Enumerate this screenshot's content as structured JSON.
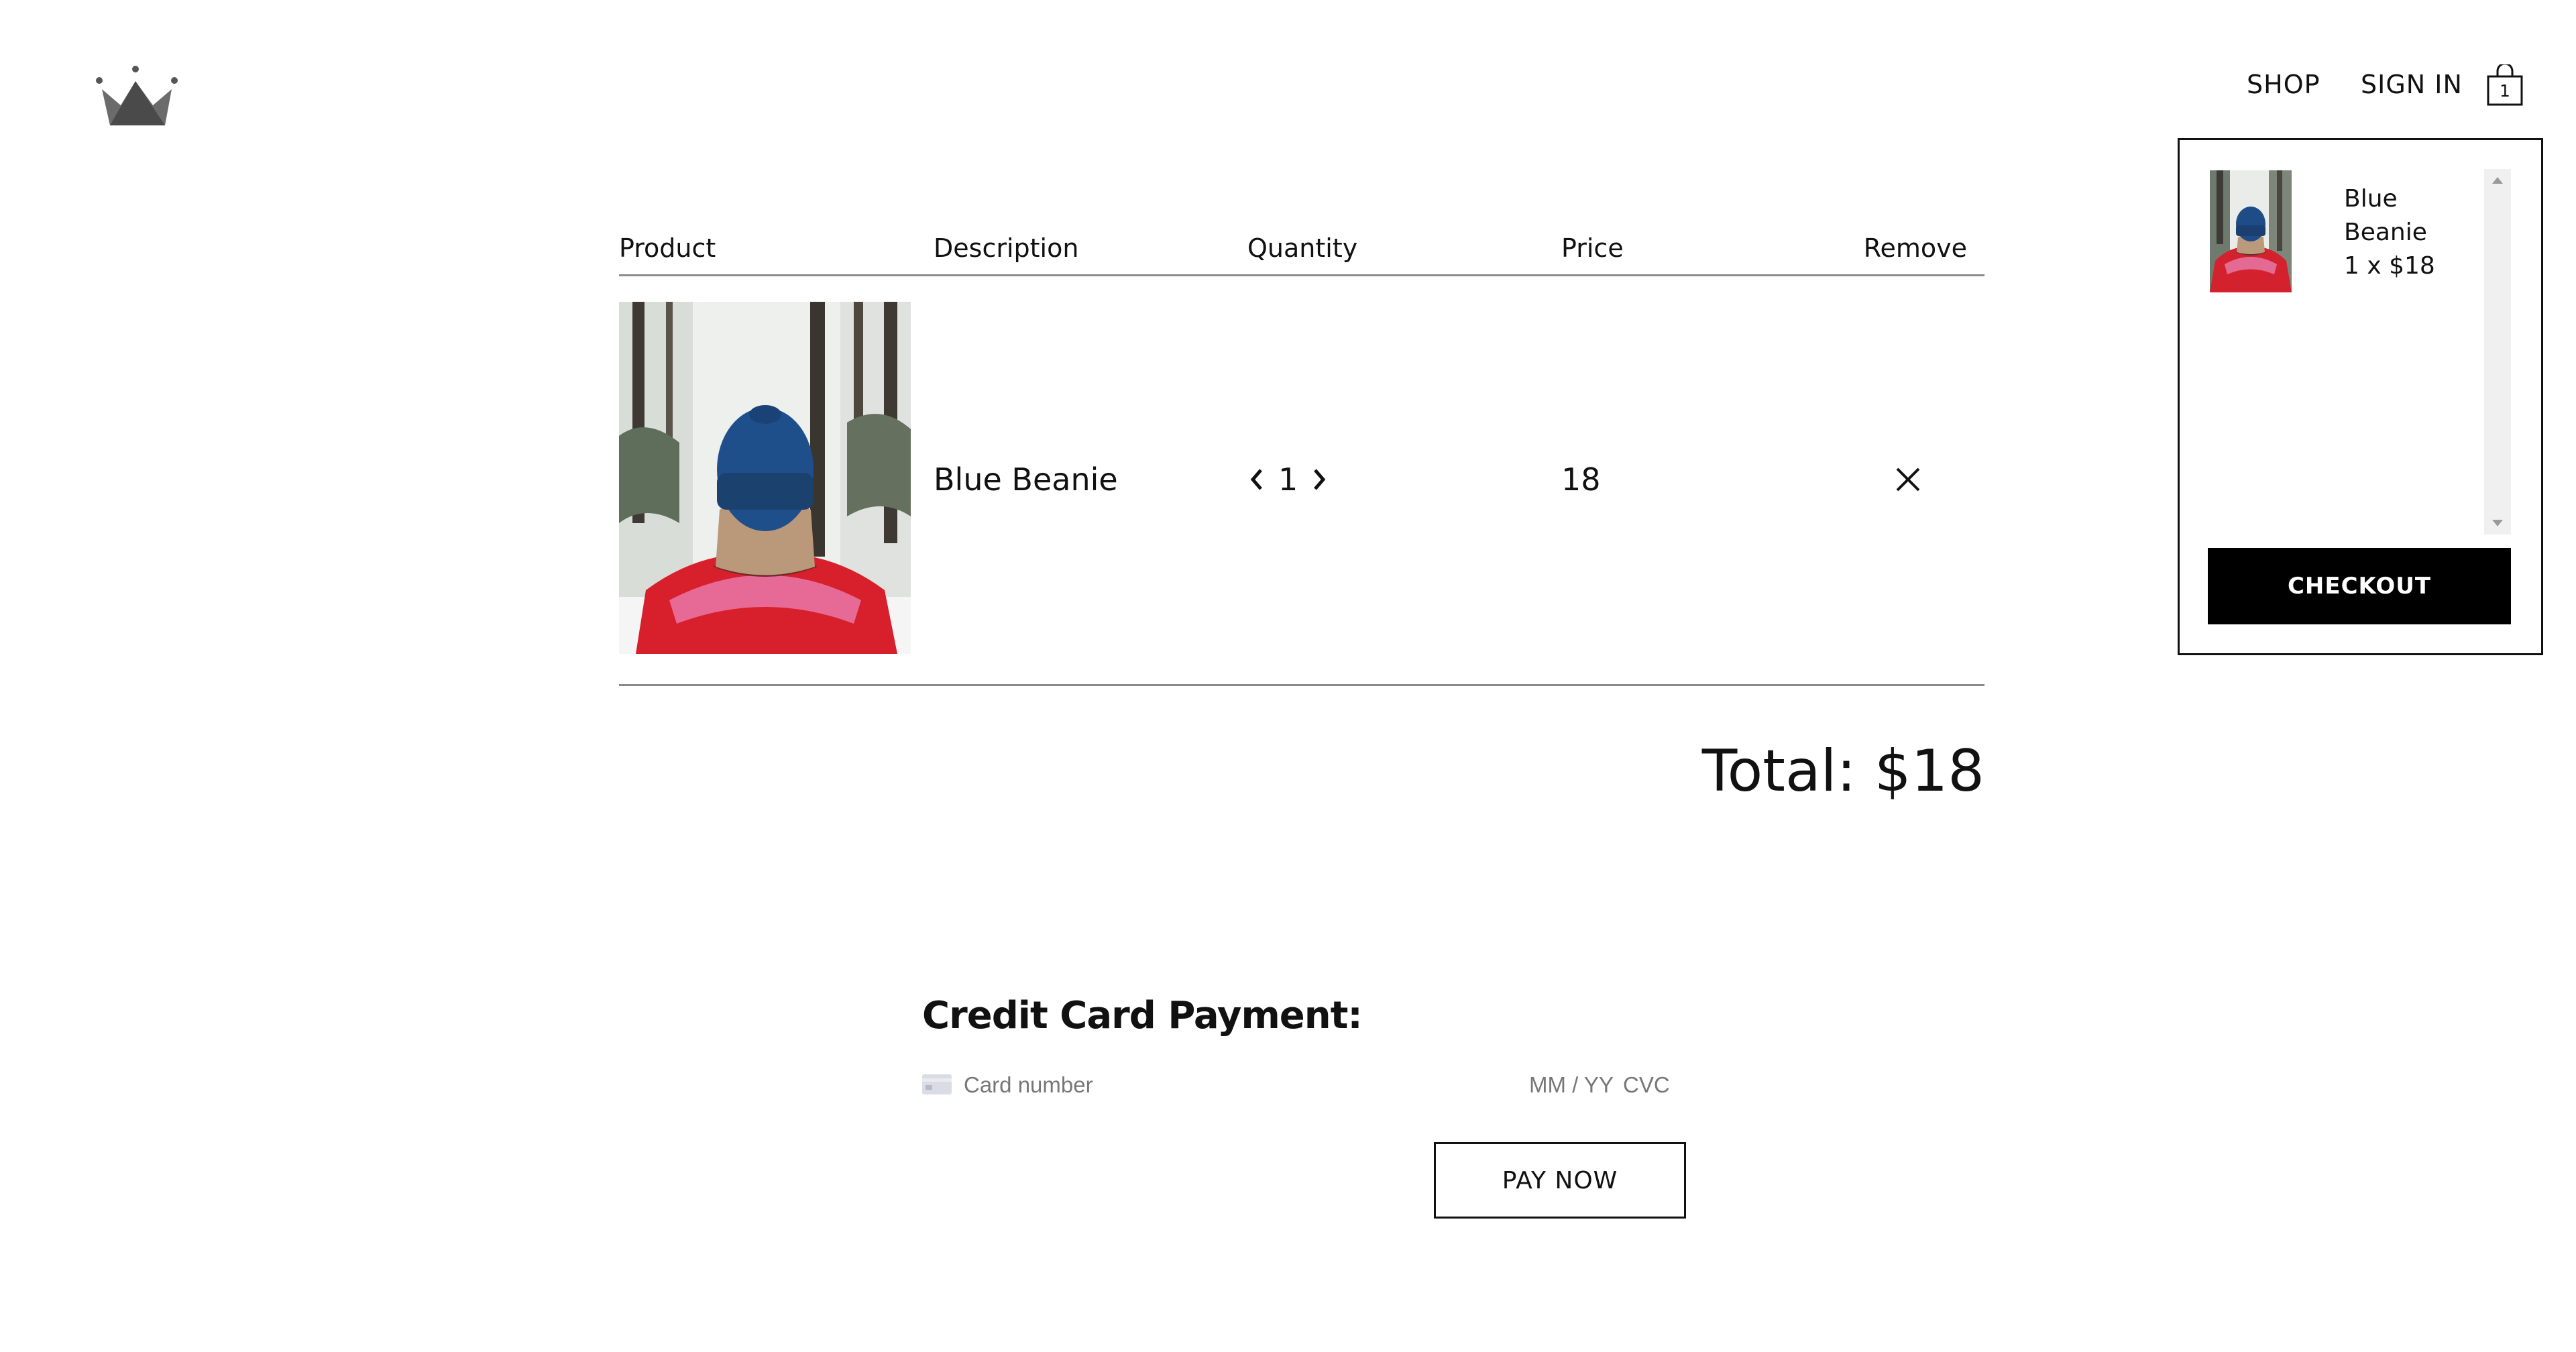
{
  "header": {
    "nav": {
      "shop": "SHOP",
      "sign_in": "SIGN IN"
    },
    "cart_count": "1"
  },
  "cart_dropdown": {
    "items": [
      {
        "name": "Blue Beanie",
        "line": "1 x $18"
      }
    ],
    "checkout_label": "CHECKOUT"
  },
  "checkout_table": {
    "headers": {
      "product": "Product",
      "description": "Description",
      "quantity": "Quantity",
      "price": "Price",
      "remove": "Remove"
    },
    "items": [
      {
        "name": "Blue Beanie",
        "quantity": "1",
        "price": "18"
      }
    ]
  },
  "total": "Total: $18",
  "payment": {
    "title": "Credit Card Payment:",
    "card_number_placeholder": "Card number",
    "expiry_placeholder": "MM / YY",
    "cvc_placeholder": "CVC",
    "pay_label": "PAY NOW"
  },
  "colors": {
    "accent": "#000000",
    "divider": "#8a8a8a",
    "logo": "#555555",
    "placeholder": "#777777"
  },
  "icons": {
    "logo": "crown-logo-icon",
    "bag": "shopping-bag-icon",
    "qty_decrease": "chevron-left-icon",
    "qty_increase": "chevron-right-icon",
    "remove": "close-icon",
    "card": "credit-card-icon"
  }
}
